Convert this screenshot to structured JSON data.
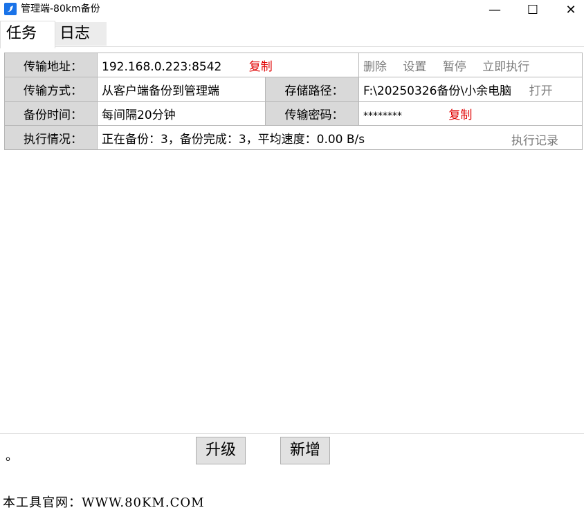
{
  "window": {
    "title": "管理端-80km备份",
    "min_glyph": "—",
    "max_glyph": "☐",
    "close_glyph": "✕"
  },
  "tabs": [
    {
      "label": "任务",
      "active": true
    },
    {
      "label": "日志",
      "active": false
    }
  ],
  "task": {
    "address_label": "传输地址：",
    "address_value": "192.168.0.223:8542",
    "copy_label": "复制",
    "delete_label": "删除",
    "settings_label": "设置",
    "pause_label": "暂停",
    "run_now_label": "立即执行",
    "mode_label": "传输方式：",
    "mode_value": "从客户端备份到管理端",
    "path_label": "存储路径：",
    "path_value": "F:\\20250326备份\\小余电脑",
    "open_label": "打开",
    "time_label": "备份时间：",
    "time_value": "每间隔20分钟",
    "password_label": "传输密码：",
    "password_value": "********",
    "password_copy_label": "复制",
    "status_label": "执行情况：",
    "status_value": "正在备份：3，备份完成：3，平均速度：0.00 B/s",
    "history_label": "执行记录"
  },
  "bottom": {
    "dot": "。",
    "upgrade_label": "升级",
    "new_label": "新增"
  },
  "footer": {
    "text": "本工具官网：WWW.80KM.COM"
  },
  "colors": {
    "accent_red": "#e00000",
    "label_bg": "#d9d9d9",
    "link_gray": "#7a7a7a"
  }
}
